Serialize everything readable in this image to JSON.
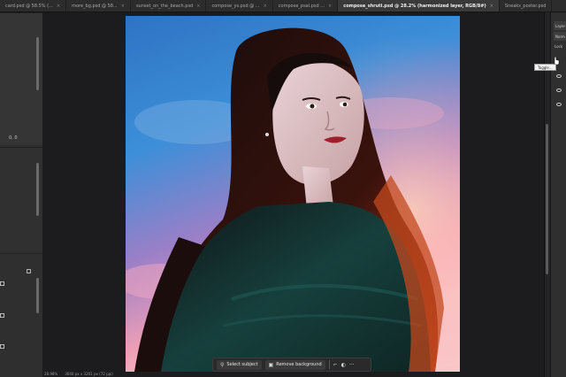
{
  "tabs": [
    {
      "label": "card.psd @ 58.5% (...",
      "active": false
    },
    {
      "label": "more_bg.psd @ 58...",
      "active": false
    },
    {
      "label": "sunset_on_the_beach.psd",
      "active": false
    },
    {
      "label": "compose_ys.psd @ ...",
      "active": false
    },
    {
      "label": "compose_psal.psd ...",
      "active": false
    },
    {
      "label": "compose_shruti.psd @ 28.2% (harmonized layer, RGB/8#)",
      "active": true
    },
    {
      "label": "Sneaks_poster.psd",
      "active": false
    }
  ],
  "left_panel": {
    "coord_readout": "0, 0"
  },
  "right_panel": {
    "button_1": "Layer",
    "button_2": "Norm",
    "lock_label": "Lock",
    "tooltip": "Toggle..."
  },
  "taskbar": {
    "select_subject": "Select subject",
    "remove_background": "Remove background",
    "more": "···"
  },
  "status": {
    "zoom": "28.98%",
    "doc_size": "3040 px x 3201 px (72 ppi)"
  },
  "icons": {
    "select_subject": "person-icon",
    "remove_background": "image-icon",
    "transform": "transform-icon",
    "mask": "mask-icon"
  }
}
